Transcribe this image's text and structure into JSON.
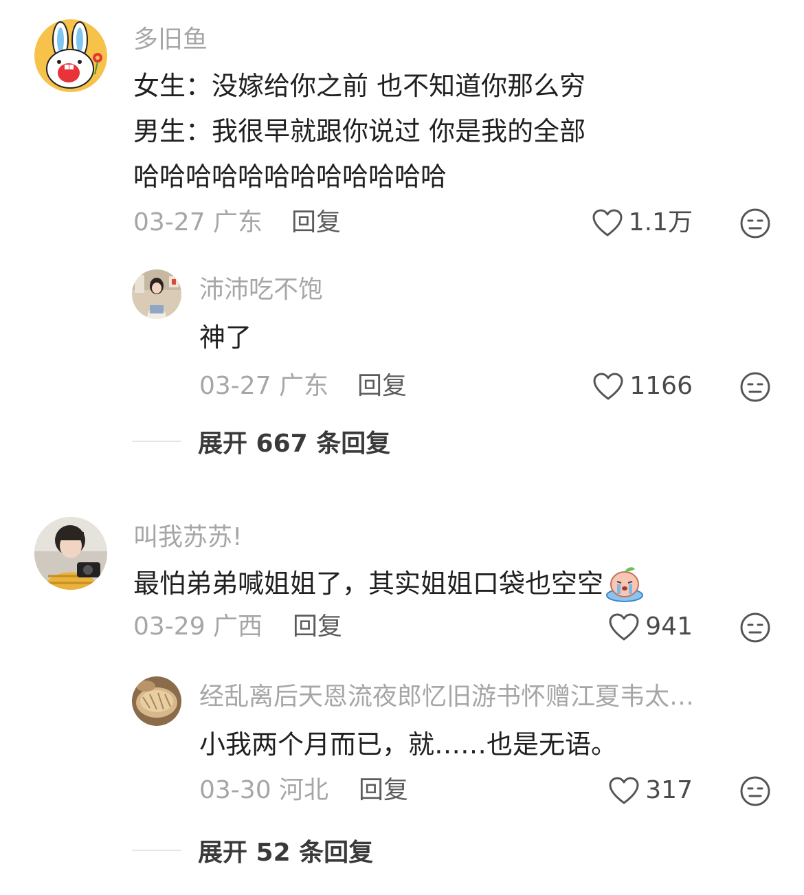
{
  "comments": [
    {
      "username": "多旧鱼",
      "lines": [
        "女生：没嫁给你之前 也不知道你那么穷",
        "男生：我很早就跟你说过 你是我的全部",
        "哈哈哈哈哈哈哈哈哈哈哈哈"
      ],
      "date_location": "03-27 广东",
      "reply_label": "回复",
      "likes": "1.1万",
      "avatar": "rabbit-cartoon",
      "replies": [
        {
          "username": "沛沛吃不饱",
          "text": "神了",
          "date_location": "03-27 广东",
          "reply_label": "回复",
          "likes": "1166",
          "avatar": "girl-photo"
        }
      ],
      "expand_label": "展开 667 条回复"
    },
    {
      "username": "叫我苏苏!",
      "lines": [
        "最怕弟弟喊姐姐了，其实姐姐口袋也空空"
      ],
      "date_location": "03-29 广西",
      "reply_label": "回复",
      "likes": "941",
      "avatar": "boy-photo",
      "replies": [
        {
          "username": "经乱离后天恩流夜郎忆旧游书怀赠江夏韦太…",
          "text": "小我两个月而已，就……也是无语。",
          "date_location": "03-30 河北",
          "reply_label": "回复",
          "likes": "317",
          "avatar": "bread-photo"
        }
      ],
      "expand_label": "展开 52 条回复"
    }
  ],
  "icons": {
    "like": "heart-outline-icon",
    "reaction": "neutral-face-icon",
    "sticker": "crying-peach-sticker"
  },
  "colors": {
    "username": "#a6a6a6",
    "text": "#202020",
    "meta": "#a6a6a6",
    "reply": "#5c5c5c"
  }
}
